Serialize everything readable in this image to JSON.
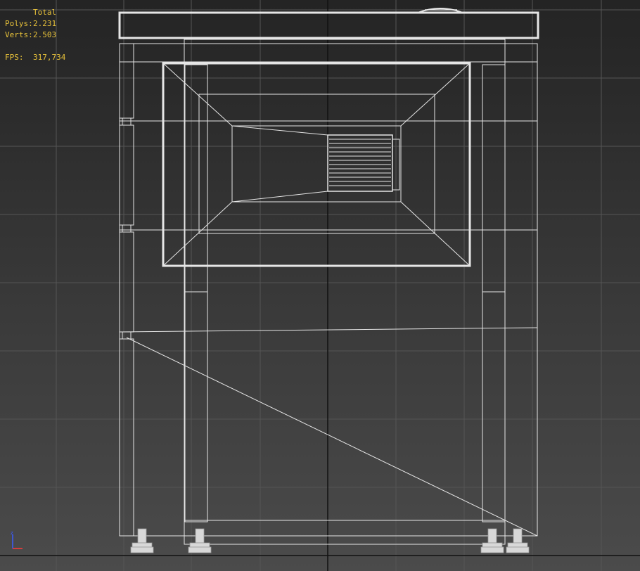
{
  "viewport": {
    "stats": {
      "header": "Total",
      "polys_label": "Polys:",
      "polys_value": "2.231",
      "verts_label": "Verts:",
      "verts_value": "2.503",
      "fps_label": "FPS:",
      "fps_value": "317,734"
    },
    "shading_mode": "wireframe",
    "gizmo_axes": [
      "y",
      "x"
    ],
    "colors": {
      "stats_text": "#e8c23a",
      "wire": "#e6e6e6",
      "grid": "#555555",
      "world_axis": "#111111",
      "axis_y": "#3a5cff",
      "axis_x": "#ff3a3a"
    }
  }
}
